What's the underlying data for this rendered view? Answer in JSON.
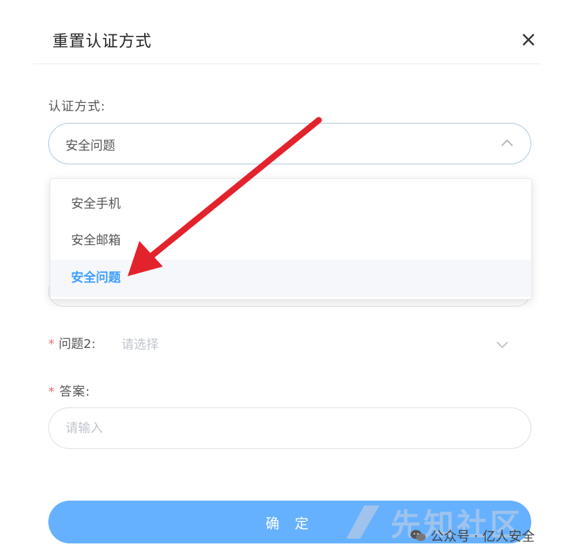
{
  "dialog": {
    "title": "重置认证方式",
    "close_label": "×"
  },
  "auth_method": {
    "label": "认证方式:",
    "selected_value": "安全问题",
    "options": [
      "安全手机",
      "安全邮箱",
      "安全问题"
    ]
  },
  "question2": {
    "required_mark": "*",
    "label": "问题2:",
    "placeholder": "请选择"
  },
  "answer": {
    "required_mark": "*",
    "label": "答案:",
    "placeholder": "请输入"
  },
  "confirm_button": {
    "label": "确 定"
  },
  "watermark": {
    "site_text": "先知社区",
    "account_text": "公众号 · 亿人安全"
  },
  "colors": {
    "accent": "#409eff",
    "button": "#66b1ff",
    "required": "#f56c6c",
    "annotation_arrow": "#e3232c"
  },
  "icons": {
    "close": "close-icon",
    "dropdown_open": "chevron-up-icon",
    "dropdown_closed": "chevron-down-icon",
    "wechat": "wechat-icon"
  }
}
